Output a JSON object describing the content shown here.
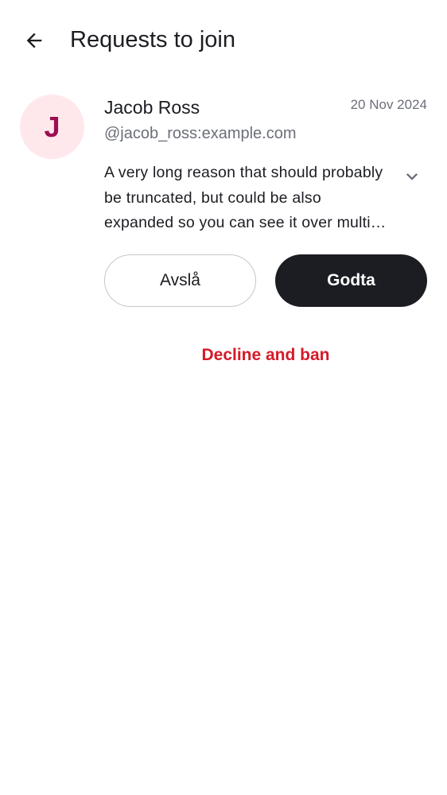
{
  "header": {
    "back_icon": "arrow-left-icon",
    "title": "Requests to join"
  },
  "requests": [
    {
      "avatar_letter": "J",
      "name": "Jacob Ross",
      "user_id": "@jacob_ross:example.com",
      "date": "20 Nov 2024",
      "reason": "A very long reason that should probably be truncated, but could be also expanded so you can see it over multiple lines.",
      "expand_icon": "chevron-down-icon",
      "decline_label": "Avslå",
      "accept_label": "Godta",
      "decline_ban_label": "Decline and ban"
    }
  ],
  "colors": {
    "avatar_bg": "#ffe8ec",
    "avatar_fg": "#9b0e52",
    "primary_button": "#1b1d22",
    "critical": "#d51928",
    "secondary_text": "#6b6f78"
  }
}
